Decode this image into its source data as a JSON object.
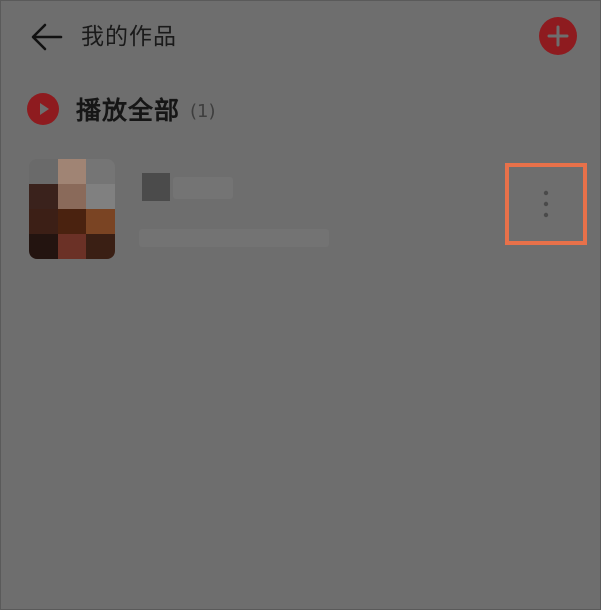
{
  "header": {
    "title": "我的作品",
    "back_icon": "arrow-left-icon",
    "add_icon": "plus-icon"
  },
  "play_all": {
    "label": "播放全部",
    "count": "(1)",
    "icon": "play-icon"
  },
  "works": [
    {
      "more_icon": "more-vertical-icon"
    }
  ],
  "colors": {
    "background": "#6e6e6e",
    "accent": "#8e1b1f",
    "highlight": "#e8714a"
  }
}
